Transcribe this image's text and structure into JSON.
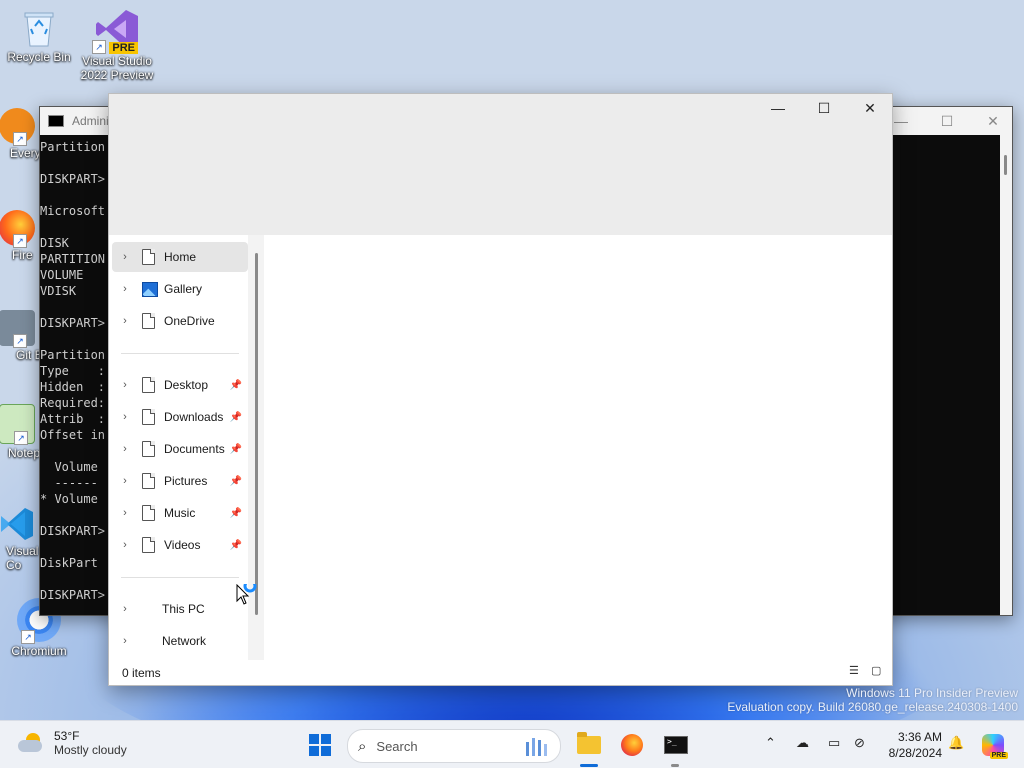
{
  "desktop": {
    "icons": [
      {
        "label": "Recycle Bin",
        "icon": "recycle-bin-icon"
      },
      {
        "label": "Visual Studio 2022 Preview",
        "icon": "visual-studio-icon",
        "badge": "PRE"
      },
      {
        "label": "Every",
        "icon": "everything-icon"
      },
      {
        "label": "Fire",
        "icon": "firefox-icon"
      },
      {
        "label": "Git B",
        "icon": "git-bash-icon"
      },
      {
        "label": "Notep",
        "icon": "notepad-icon"
      },
      {
        "label": "Visual Co",
        "icon": "vscode-icon"
      },
      {
        "label": "Chromium",
        "icon": "chromium-icon"
      }
    ],
    "watermark": {
      "line1": "Windows 11 Pro Insider Preview",
      "line2": "Evaluation copy. Build 26080.ge_release.240308-1400"
    }
  },
  "console": {
    "title": "Admini",
    "lines": [
      "Partition",
      "",
      "DISKPART>",
      "",
      "Microsoft",
      "",
      "DISK",
      "PARTITION",
      "VOLUME",
      "VDISK",
      "",
      "DISKPART>",
      "",
      "Partition",
      "Type    :",
      "Hidden  :",
      "Required:",
      "Attrib  :",
      "Offset in",
      "",
      "  Volume",
      "  ------",
      "* Volume",
      "",
      "DISKPART>",
      "",
      "DiskPart",
      "",
      "DISKPART>"
    ]
  },
  "explorer": {
    "controls": {
      "minimize": "—",
      "maximize": "☐",
      "close": "✕"
    },
    "nav": {
      "group1": [
        {
          "label": "Home",
          "icon": "document-icon",
          "selected": true
        },
        {
          "label": "Gallery",
          "icon": "gallery-icon"
        },
        {
          "label": "OneDrive",
          "icon": "document-icon"
        }
      ],
      "group2": [
        {
          "label": "Desktop",
          "icon": "document-icon",
          "pinned": true
        },
        {
          "label": "Downloads",
          "icon": "document-icon",
          "pinned": true
        },
        {
          "label": "Documents",
          "icon": "document-icon",
          "pinned": true
        },
        {
          "label": "Pictures",
          "icon": "document-icon",
          "pinned": true
        },
        {
          "label": "Music",
          "icon": "document-icon",
          "pinned": true
        },
        {
          "label": "Videos",
          "icon": "document-icon",
          "pinned": true
        }
      ],
      "group3": [
        {
          "label": "This PC"
        },
        {
          "label": "Network"
        }
      ]
    },
    "status": {
      "item_count": "0 items"
    }
  },
  "taskbar": {
    "weather": {
      "temp": "53°F",
      "condition": "Mostly cloudy"
    },
    "search_placeholder": "Search",
    "clock": {
      "time": "3:36 AM",
      "date": "8/28/2024"
    },
    "copilot_badge": "PRE",
    "colors": {
      "accent": "#0f6cd8",
      "active_indicator": "#0f6cd8"
    }
  }
}
